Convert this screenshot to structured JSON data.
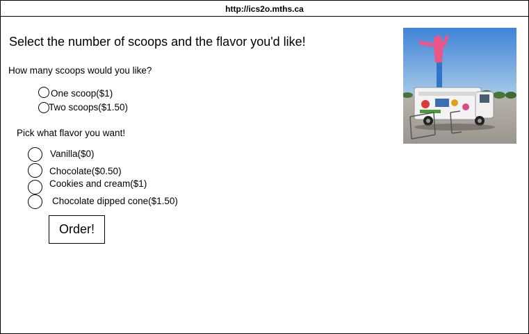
{
  "browser": {
    "url": "http://ics2o.mths.ca"
  },
  "page": {
    "heading": "Select the number of scoops and the flavor you'd like!"
  },
  "scoops": {
    "question": "How many scoops would you like?",
    "options": [
      {
        "label": "One scoop($1)",
        "selected": false
      },
      {
        "label": "Two scoops($1.50)",
        "selected": false
      }
    ]
  },
  "flavors": {
    "question": "Pick what flavor you want!",
    "options": [
      {
        "label": "Vanilla($0)",
        "selected": false
      },
      {
        "label": "Chocolate($0.50)",
        "selected": false
      },
      {
        "label": "Cookies and cream($1)",
        "selected": false
      },
      {
        "label": "Chocolate dipped cone($1.50)",
        "selected": false
      }
    ]
  },
  "order_button": {
    "label": "Order!"
  },
  "image": {
    "subject": "ice-cream-truck-photo"
  }
}
